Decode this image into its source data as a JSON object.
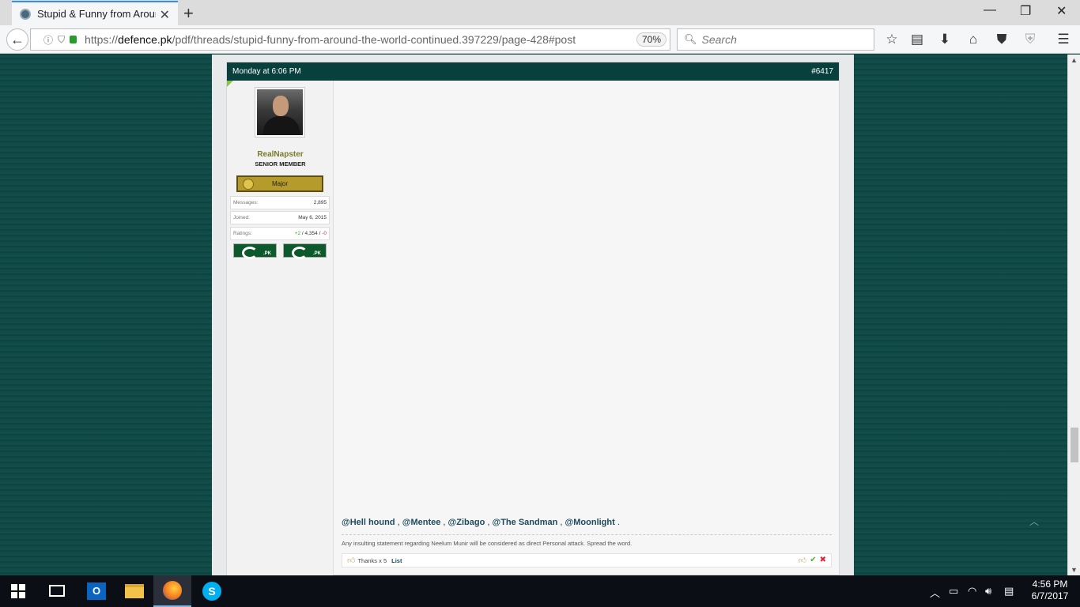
{
  "browser": {
    "tab_title": "Stupid & Funny from Aroun",
    "url_host": "defence.pk",
    "url_prefix": "https://",
    "url_path": "/pdf/threads/stupid-funny-from-around-the-world-continued.397229/page-428#post",
    "zoom": "70%",
    "search_placeholder": "Search"
  },
  "post": {
    "date": "Monday at 6:06 PM",
    "number": "#6417",
    "user": {
      "name": "RealNapster",
      "title": "SENIOR MEMBER",
      "rank": "Major",
      "stats": [
        {
          "label": "Messages:",
          "value": "2,895"
        },
        {
          "label": "Joined:",
          "value": "May 6, 2015"
        }
      ],
      "ratings_label": "Ratings:",
      "ratings_pos": "+2",
      "ratings_sep1": " / ",
      "ratings_mid": "4,354",
      "ratings_sep2": " / ",
      "ratings_neg": "-0",
      "flag_text": ".PK"
    },
    "mentions": [
      "@Hell hound",
      "@Mentee",
      "@Zibago",
      "@The Sandman",
      "@Moonlight"
    ],
    "mention_sep": " , ",
    "mention_end": " .",
    "signature": "Any insulting statement regarding Neelum Munir will be considered as direct Personal attack. Spread the word.",
    "thanks": "Thanks x 5",
    "list_link": "List"
  },
  "taskbar": {
    "time": "4:56 PM",
    "date": "6/7/2017"
  }
}
